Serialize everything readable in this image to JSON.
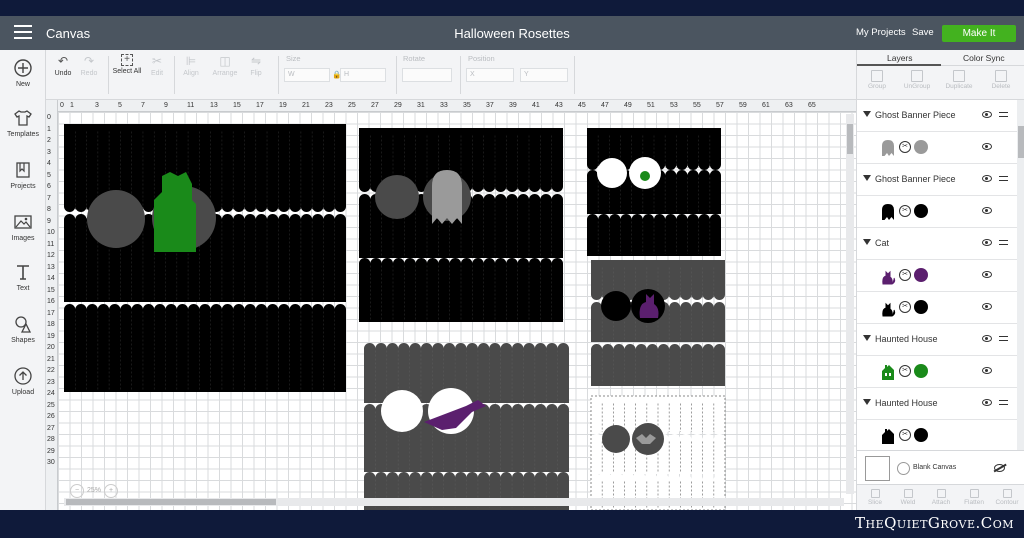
{
  "topbar": {
    "tab": "Canvas",
    "title": "Halloween Rosettes",
    "my_projects": "My Projects",
    "save": "Save",
    "make_it": "Make It"
  },
  "toolbar": {
    "undo": "Undo",
    "redo": "Redo",
    "select_all": "Select All",
    "edit": "Edit",
    "align": "Align",
    "arrange": "Arrange",
    "flip": "Flip",
    "size": "Size",
    "w": "W",
    "h": "H",
    "rotate": "Rotate",
    "position": "Position",
    "x": "X",
    "y": "Y"
  },
  "leftbar": {
    "items": [
      {
        "label": "New",
        "icon": "plus-circle-icon"
      },
      {
        "label": "Templates",
        "icon": "shirt-icon"
      },
      {
        "label": "Projects",
        "icon": "projects-icon"
      },
      {
        "label": "Images",
        "icon": "image-icon"
      },
      {
        "label": "Text",
        "icon": "text-icon"
      },
      {
        "label": "Shapes",
        "icon": "shapes-icon"
      },
      {
        "label": "Upload",
        "icon": "upload-icon"
      }
    ]
  },
  "canvas": {
    "ruler_top": [
      "0",
      "1",
      "3",
      "5",
      "7",
      "9",
      "11",
      "13",
      "15",
      "17",
      "19",
      "21",
      "23",
      "25",
      "27",
      "29",
      "31",
      "33",
      "35",
      "37",
      "39",
      "41",
      "43",
      "45",
      "47",
      "49",
      "51",
      "53",
      "55",
      "57",
      "59",
      "61",
      "63",
      "65"
    ],
    "ruler_left": [
      "0",
      "1",
      "2",
      "3",
      "4",
      "5",
      "6",
      "7",
      "8",
      "9",
      "10",
      "11",
      "12",
      "13",
      "14",
      "15",
      "16",
      "17",
      "18",
      "19",
      "20",
      "21",
      "22",
      "23",
      "24",
      "25",
      "26",
      "27",
      "28",
      "29",
      "30"
    ],
    "zoom": "25%"
  },
  "rightpanel": {
    "tabs": [
      "Layers",
      "Color Sync"
    ],
    "tools": [
      "Group",
      "UnGroup",
      "Duplicate",
      "Delete"
    ],
    "layers": [
      {
        "name": "Ghost Banner Piece",
        "items": [
          {
            "color": "#9a9a9a"
          }
        ]
      },
      {
        "name": "Ghost Banner Piece",
        "items": [
          {
            "color": "#000000"
          }
        ]
      },
      {
        "name": "Cat",
        "items": [
          {
            "color": "#5b1f6e"
          },
          {
            "color": "#000000"
          }
        ]
      },
      {
        "name": "Haunted House",
        "items": [
          {
            "color": "#1a8a1a"
          }
        ]
      },
      {
        "name": "Haunted House",
        "items": [
          {
            "color": "#000000"
          }
        ]
      }
    ],
    "blank_canvas": "Blank Canvas",
    "bottom_tools": [
      "Slice",
      "Weld",
      "Attach",
      "Flatten",
      "Contour"
    ]
  },
  "watermark": "TheQuietGrove.Com",
  "colors": {
    "topbar": "#4b5560",
    "make_it": "#43b21f",
    "background": "#0f1a3a"
  }
}
